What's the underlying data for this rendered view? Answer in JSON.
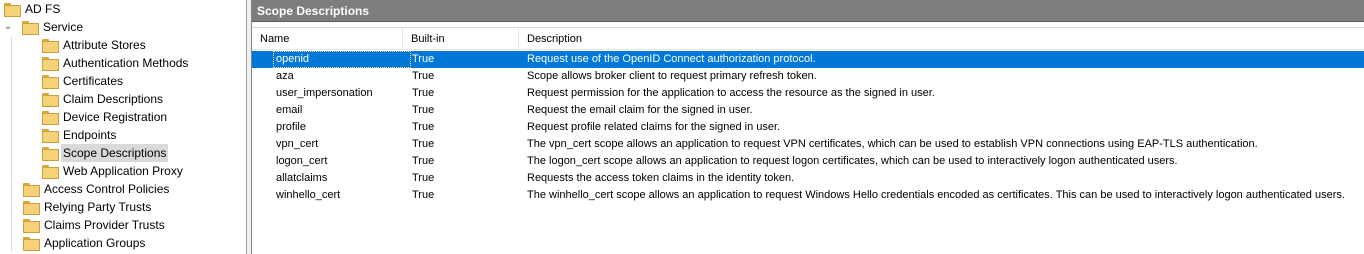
{
  "tree": {
    "root": {
      "label": "AD FS"
    },
    "service": {
      "label": "Service",
      "expanded": true
    },
    "service_children": [
      {
        "label": "Attribute Stores"
      },
      {
        "label": "Authentication Methods"
      },
      {
        "label": "Certificates"
      },
      {
        "label": "Claim Descriptions"
      },
      {
        "label": "Device Registration"
      },
      {
        "label": "Endpoints"
      },
      {
        "label": "Scope Descriptions",
        "selected": true
      },
      {
        "label": "Web Application Proxy"
      }
    ],
    "siblings": [
      {
        "label": "Access Control Policies"
      },
      {
        "label": "Relying Party Trusts"
      },
      {
        "label": "Claims Provider Trusts"
      },
      {
        "label": "Application Groups"
      }
    ]
  },
  "pane": {
    "title": "Scope Descriptions",
    "columns": [
      "Name",
      "Built-in",
      "Description"
    ],
    "rows": [
      {
        "name": "openid",
        "builtin": "True",
        "description": "Request use of the OpenID Connect authorization protocol.",
        "selected": true
      },
      {
        "name": "aza",
        "builtin": "True",
        "description": "Scope allows broker client to request primary refresh token."
      },
      {
        "name": "user_impersonation",
        "builtin": "True",
        "description": "Request permission for the application to access the resource as the signed in user."
      },
      {
        "name": "email",
        "builtin": "True",
        "description": "Request the email claim for the signed in user."
      },
      {
        "name": "profile",
        "builtin": "True",
        "description": "Request profile related claims for the signed in user."
      },
      {
        "name": "vpn_cert",
        "builtin": "True",
        "description": "The vpn_cert scope allows an application to request VPN certificates, which can be used to establish VPN connections using EAP-TLS authentication."
      },
      {
        "name": "logon_cert",
        "builtin": "True",
        "description": "The logon_cert scope allows an application to request logon certificates, which can be used to interactively logon authenticated users."
      },
      {
        "name": "allatclaims",
        "builtin": "True",
        "description": "Requests the access token claims in the identity token."
      },
      {
        "name": "winhello_cert",
        "builtin": "True",
        "description": "The winhello_cert scope allows an application to request Windows Hello credentials encoded as certificates. This can be used to interactively logon authenticated users."
      }
    ]
  },
  "colors": {
    "header_bg": "#7d7d7d",
    "selection": "#0078d7",
    "tree_selection": "#d9d9d9",
    "folder": "#f5d27a"
  }
}
